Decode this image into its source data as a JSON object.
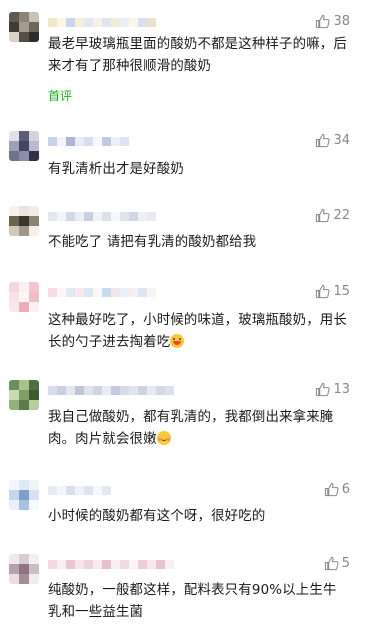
{
  "comments": [
    {
      "likes": "38",
      "text": "最老早玻璃瓶里面的酸奶不都是这种样子的嘛，后来才有了那种很顺滑的酸奶",
      "badge": "首评",
      "avatar_colors": [
        "#5d5a54",
        "#8a8378",
        "#c8c2b6",
        "#3f3c38",
        "#a49b8d",
        "#6e665c",
        "#d9d3c7",
        "#574f47",
        "#2f2c29"
      ],
      "name_colors": [
        "#f0e9c7",
        "#fbf7e3",
        "#c9d6ee",
        "#f3efd9",
        "#e3e7f1",
        "#f6f3e6",
        "#dfe6f2",
        "#f2edd7",
        "#ebeef5",
        "#f9f6ea",
        "#d8dff0",
        "#e8e2cf"
      ]
    },
    {
      "likes": "34",
      "text": "有乳清析出才是好酸奶",
      "avatar_colors": [
        "#e2dfe6",
        "#5a5d78",
        "#d2d3de",
        "#9ea0b6",
        "#434660",
        "#b9bbcc",
        "#6e7190",
        "#8b8ea9",
        "#2e3148"
      ],
      "name_colors": [
        "#c8d2e8",
        "#f1f3f8",
        "#a9b6d6",
        "#e9ecf4",
        "#d8def0",
        "#f6f7fb",
        "#bfcae5",
        "#eef0f7",
        "#dde3f2"
      ]
    },
    {
      "likes": "22",
      "text": "不能吃了 请把有乳清的酸奶都给我",
      "avatar_colors": [
        "#f6f3ee",
        "#e9e4dc",
        "#f1ece6",
        "#6c6254",
        "#3b342c",
        "#8e8272",
        "#d3c9bb",
        "#a2958a",
        "#f4efe8"
      ],
      "name_colors": [
        "#e4e7ef",
        "#f3f4f8",
        "#d4d9e6",
        "#ebeef4",
        "#c9cfe0",
        "#f0f2f7",
        "#dce0eb",
        "#f6f7fa",
        "#e0e4ee",
        "#d0d6e6",
        "#eef0f5",
        "#e7eaf2"
      ]
    },
    {
      "likes": "15",
      "text": "这种最好吃了，小时候的味道，玻璃瓶酸奶，用长长的勺子进去掏着吃",
      "emoji": "grin",
      "avatar_colors": [
        "#f4d6db",
        "#fbeff1",
        "#f1c6cf",
        "#f7e2e6",
        "#fdf5f6",
        "#efbfc9",
        "#f9e8eb",
        "#e8aebb",
        "#fbf1f3"
      ],
      "name_colors": [
        "#f6dde2",
        "#fdf4f6",
        "#e4e8f1",
        "#f9e9ec",
        "#d9e9f4",
        "#fbf7f8",
        "#c9dcec",
        "#f3e6ea",
        "#e9f0f7",
        "#f7eef1",
        "#dde6f0",
        "#f9f3f5"
      ]
    },
    {
      "likes": "13",
      "text": "我自己做酸奶，都有乳清的，我都倒出来拿来腌肉。肉片就会很嫩",
      "emoji": "cheeks",
      "avatar_colors": [
        "#6b8f5a",
        "#a8c48e",
        "#4f6f43",
        "#c7dbb2",
        "#7fa064",
        "#3d5a33",
        "#93b27a",
        "#5c7d4b",
        "#b6cf9f"
      ],
      "name_colors": [
        "#d8dce8",
        "#c9cfe0",
        "#e4e7ef",
        "#bfc6da",
        "#dfe3ed",
        "#cfd5e4",
        "#e9ecf3",
        "#c4cbde",
        "#d6dbe8",
        "#e1e5ee",
        "#cdd3e3",
        "#e7eaf1",
        "#d3d8e6",
        "#dde1ec"
      ]
    },
    {
      "likes": "6",
      "text": "小时候的酸奶都有这个呀，很好吃的",
      "avatar_colors": [
        "#f3f6fb",
        "#dfe8f4",
        "#eef3f9",
        "#c6d6ec",
        "#7f9fc9",
        "#d6e2f1",
        "#e9f0f8",
        "#a9c0df",
        "#f6f9fc"
      ],
      "name_colors": [
        "#e6ebf4",
        "#f3f5f9",
        "#d7deec",
        "#eef1f6",
        "#dde3ef",
        "#f6f7fa",
        "#e3e8f2"
      ]
    },
    {
      "likes": "5",
      "text": "纯酸奶，一般都这样，配料表只有90%以上生牛乳和一些益生菌",
      "avatar_colors": [
        "#efe8ec",
        "#d9cbd3",
        "#f4eef1",
        "#b7a0ad",
        "#8e7482",
        "#cdbcc5",
        "#e7dde2",
        "#a48d99",
        "#f2ecef"
      ],
      "name_colors": [
        "#f4d9e2",
        "#fbeef2",
        "#e9c6d3",
        "#f8e5eb",
        "#eed2dc",
        "#f6ebef",
        "#e4bfcc",
        "#f9eef2",
        "#f0dbe3",
        "#fbf3f6",
        "#eccdd8",
        "#f7e7ed",
        "#e6c3d0",
        "#f9f0f4"
      ]
    }
  ]
}
